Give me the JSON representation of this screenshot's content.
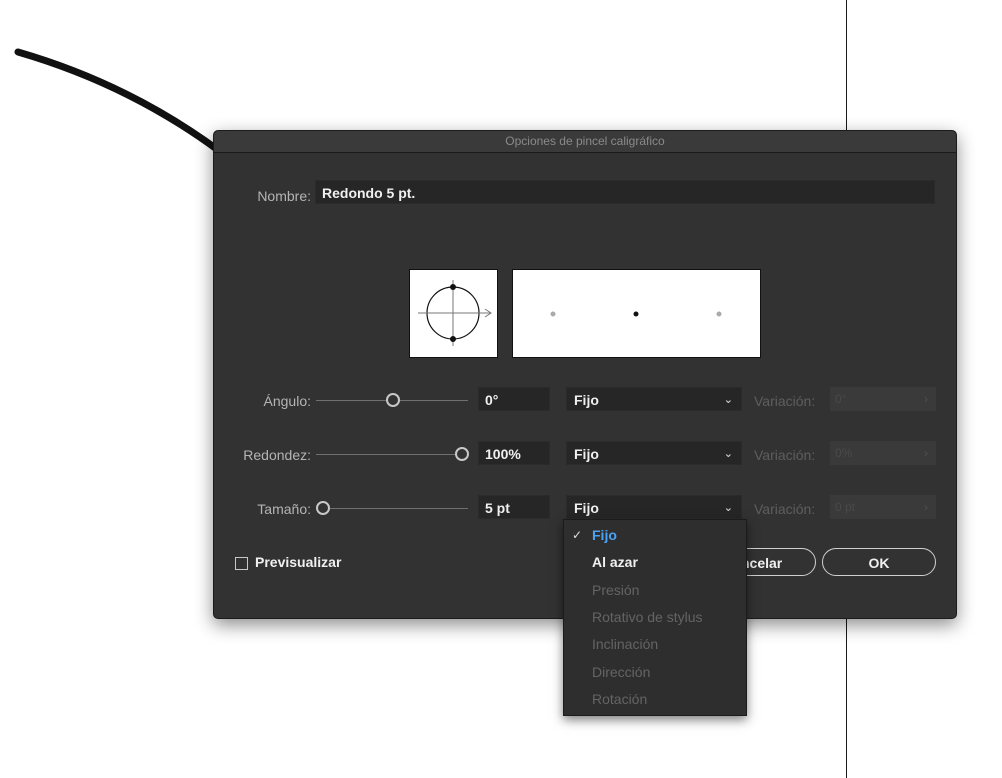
{
  "dialog": {
    "title": "Opciones de pincel caligráfico",
    "name_label": "Nombre:",
    "name_value": "Redondo 5 pt.",
    "rows": [
      {
        "label": "Ángulo:",
        "value": "0°",
        "mode": "Fijo",
        "variation_label": "Variación:",
        "variation_value": "0°"
      },
      {
        "label": "Redondez:",
        "value": "100%",
        "mode": "Fijo",
        "variation_label": "Variación:",
        "variation_value": "0%"
      },
      {
        "label": "Tamaño:",
        "value": "5 pt",
        "mode": "Fijo",
        "variation_label": "Variación:",
        "variation_value": "0 pt"
      }
    ],
    "preview_label": "Previsualizar",
    "cancel_label": "ncelar",
    "ok_label": "OK"
  },
  "dropdown": {
    "items": [
      {
        "label": "Fijo",
        "state": "selected"
      },
      {
        "label": "Al azar",
        "state": "enabled"
      },
      {
        "label": "Presión",
        "state": "disabled"
      },
      {
        "label": "Rotativo de stylus",
        "state": "disabled"
      },
      {
        "label": "Inclinación",
        "state": "disabled"
      },
      {
        "label": "Dirección",
        "state": "disabled"
      },
      {
        "label": "Rotación",
        "state": "disabled"
      }
    ]
  },
  "colors": {
    "dialog_bg": "#323232",
    "field_bg": "#262626",
    "accent": "#4aa3f5"
  }
}
